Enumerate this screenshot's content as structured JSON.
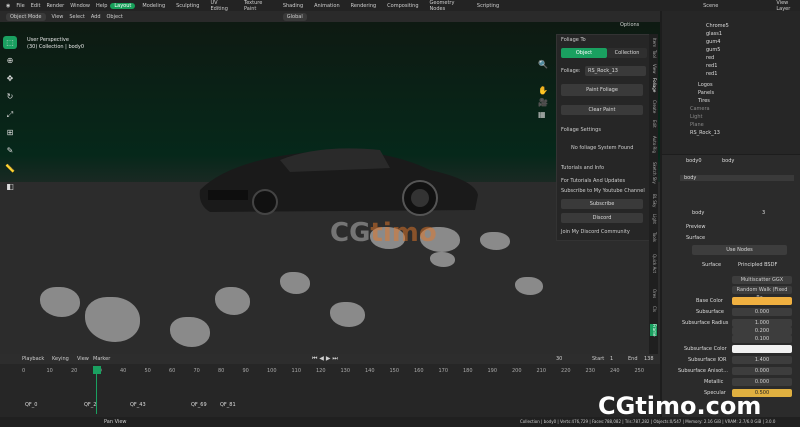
{
  "menu": {
    "items": [
      "File",
      "Edit",
      "Render",
      "Window",
      "Help"
    ],
    "workspaces": [
      "Layout",
      "Modeling",
      "Sculpting",
      "UV Editing",
      "Texture Paint",
      "Shading",
      "Animation",
      "Rendering",
      "Compositing",
      "Geometry Nodes",
      "Scripting"
    ],
    "active_workspace": "Layout",
    "scene": "Scene",
    "view_layer": "View Layer"
  },
  "header": {
    "mode": "Object Mode",
    "view": "View",
    "select": "Select",
    "add": "Add",
    "object": "Object",
    "orientation": "Global",
    "options": "Options"
  },
  "viewport": {
    "perspective": "User Perspective",
    "collection": "(30) Collection | body0"
  },
  "foliage": {
    "title": "Foliage To",
    "tab_object": "Object",
    "tab_collection": "Collection",
    "foliage_label": "Foliage:",
    "foliage_value": "RS_Rock_13",
    "paint": "Paint Foliage",
    "clear": "Clear Paint",
    "settings": "Foliage Settings",
    "no_system": "No foliage System Found",
    "tutorials": "Tutorials and Info",
    "for_tutorials": "For Tutorials And Updates",
    "subscribe_text": "Subscribe to My Youtube Channel",
    "subscribe": "Subscribe",
    "discord": "Discord",
    "join": "Join My Discord Community"
  },
  "sidetabs": [
    "Item",
    "Tool",
    "View",
    "Foliage",
    "Create",
    "Edit",
    "Auto Rig",
    "Sketch Sky",
    "BL Sky",
    "Light",
    "Tools",
    "Quick Act",
    "Ores",
    "Cls",
    "Frame"
  ],
  "outliner": {
    "items": [
      "Chrome5",
      "glass1",
      "gum4",
      "gum5",
      "red",
      "red1",
      "red1",
      "Logos",
      "Panels",
      "Tires",
      "Camera",
      "Light",
      "Plane",
      "RS_Rock_13"
    ]
  },
  "properties": {
    "object": "body0",
    "material_slot": "body",
    "slot_entry": "body",
    "material": "body",
    "user_count": "3",
    "preview": "Preview",
    "surface_header": "Surface",
    "use_nodes": "Use Nodes",
    "surface_label": "Surface",
    "surface_value": "Principled BSDF",
    "multiscatter": "Multiscatter GGX",
    "random_walk": "Random Walk (Fixed Ra...",
    "rows": [
      {
        "label": "Base Color",
        "value": ""
      },
      {
        "label": "Subsurface",
        "value": "0.000"
      },
      {
        "label": "Subsurface Radius",
        "value": "1.000"
      },
      {
        "label": "",
        "value": "0.200"
      },
      {
        "label": "",
        "value": "0.100"
      },
      {
        "label": "Subsurface Color",
        "value": ""
      },
      {
        "label": "Subsurface IOR",
        "value": "1.400"
      },
      {
        "label": "Subsurface Anisot...",
        "value": "0.000"
      },
      {
        "label": "Metallic",
        "value": "0.000"
      },
      {
        "label": "Specular",
        "value": "0.500"
      }
    ]
  },
  "timeline": {
    "playback": "Playback",
    "keying": "Keying",
    "view": "View",
    "marker": "Marker",
    "current_frame": "30",
    "start_label": "Start",
    "start": "1",
    "end_label": "End",
    "end": "138",
    "ticks": [
      "0",
      "10",
      "20",
      "30",
      "40",
      "50",
      "60",
      "70",
      "80",
      "90",
      "100",
      "110",
      "120",
      "130",
      "140",
      "150",
      "160",
      "170",
      "180",
      "190",
      "200",
      "210",
      "220",
      "230",
      "240",
      "250"
    ],
    "markers": [
      "QF_0",
      "QF_2",
      "QF_43",
      "QF_69",
      "QF_81"
    ]
  },
  "status": {
    "left": "Pan View",
    "right": "Collection | body0 | Verts:476,729 | Faces:788,082 | Tris:787,282 | Objects:0/547 | Memory: 2.16 GiB | VRAM: 2.7/6.0 GiB | 3.0.0"
  },
  "watermark": {
    "brand": "CGtimo",
    "site": "CGtimo.com"
  }
}
